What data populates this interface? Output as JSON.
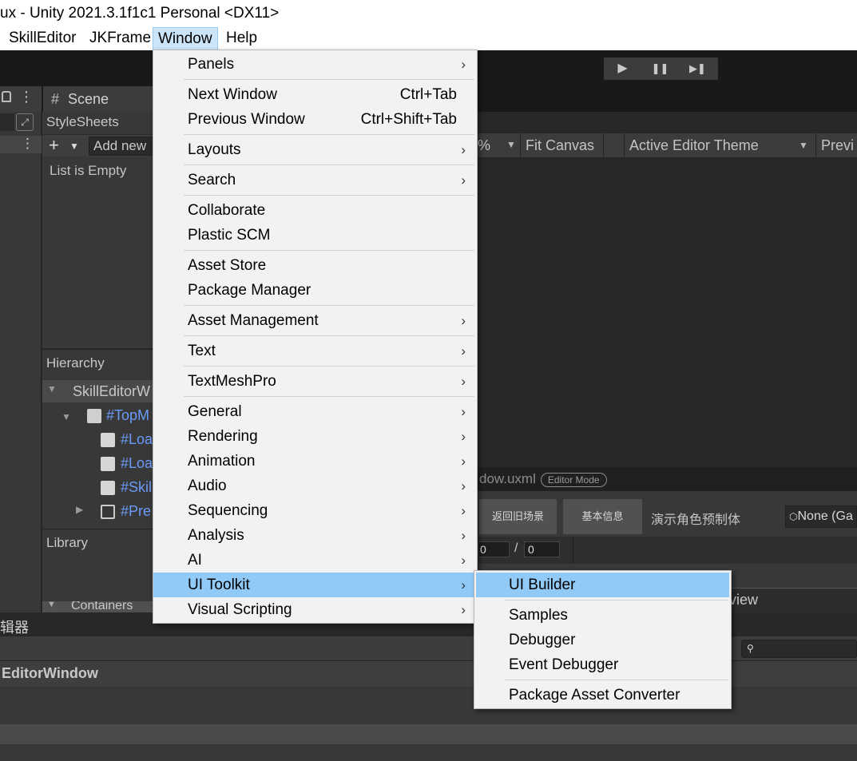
{
  "window": {
    "title": "ux - Unity 2021.3.1f1c1 Personal <DX11>"
  },
  "menubar": {
    "items": [
      {
        "label": "SkillEditor"
      },
      {
        "label": "JKFrame"
      },
      {
        "label": "Window"
      },
      {
        "label": "Help"
      }
    ]
  },
  "playbar": {
    "play": "▶",
    "pause": "❚❚",
    "step": "▶❚"
  },
  "scene_tab": {
    "label": "Scene",
    "icon": "hash-icon"
  },
  "stylesheets": {
    "title": "StyleSheets",
    "add_label": "Add new",
    "empty_text": "List is Empty"
  },
  "hierarchy": {
    "title": "Hierarchy",
    "items": [
      {
        "label": "SkillEditorW"
      },
      {
        "label": "#TopM"
      },
      {
        "label": "#Loa"
      },
      {
        "label": "#Loa"
      },
      {
        "label": "#Skil"
      },
      {
        "label": "#Pre"
      }
    ]
  },
  "library": {
    "title": "Library",
    "containers": "Containers"
  },
  "builder_toolbar": {
    "zoom_suffix": "%",
    "fit_canvas": "Fit Canvas",
    "theme": "Active Editor Theme",
    "preview": "Previ"
  },
  "canvas": {
    "file": "dow.uxml",
    "mode": "Editor Mode"
  },
  "canvas_buttons": {
    "back_scene": "返回旧场景",
    "basic_info": "基本信息",
    "preview_role": "演示角色预制体",
    "none_field": "None (Ga"
  },
  "frame_fields": {
    "start": "0",
    "sep": "/",
    "end": "0"
  },
  "view_tab": "view",
  "bottom": {
    "title": "辑器",
    "subtitle": "EditorWindow"
  },
  "window_menu": {
    "items": [
      {
        "label": "Panels",
        "submenu": true
      },
      {
        "label": "Next Window",
        "shortcut": "Ctrl+Tab"
      },
      {
        "label": "Previous Window",
        "shortcut": "Ctrl+Shift+Tab"
      },
      {
        "label": "Layouts",
        "submenu": true
      },
      {
        "label": "Search",
        "submenu": true
      },
      {
        "label": "Collaborate"
      },
      {
        "label": "Plastic SCM"
      },
      {
        "label": "Asset Store"
      },
      {
        "label": "Package Manager"
      },
      {
        "label": "Asset Management",
        "submenu": true
      },
      {
        "label": "Text",
        "submenu": true
      },
      {
        "label": "TextMeshPro",
        "submenu": true
      },
      {
        "label": "General",
        "submenu": true
      },
      {
        "label": "Rendering",
        "submenu": true
      },
      {
        "label": "Animation",
        "submenu": true
      },
      {
        "label": "Audio",
        "submenu": true
      },
      {
        "label": "Sequencing",
        "submenu": true
      },
      {
        "label": "Analysis",
        "submenu": true
      },
      {
        "label": "AI",
        "submenu": true
      },
      {
        "label": "UI Toolkit",
        "submenu": true,
        "highlighted": true
      },
      {
        "label": "Visual Scripting",
        "submenu": true
      }
    ]
  },
  "ui_toolkit_menu": {
    "items": [
      {
        "label": "UI Builder",
        "highlighted": true
      },
      {
        "label": "Samples"
      },
      {
        "label": "Debugger"
      },
      {
        "label": "Event Debugger"
      },
      {
        "label": "Package Asset Converter"
      }
    ]
  },
  "arrow_glyph": "›",
  "colors": {
    "menu_highlight": "#91c9f7",
    "menubar_active": "#cce4f7",
    "hierarchy_link": "#6b9bfa"
  }
}
